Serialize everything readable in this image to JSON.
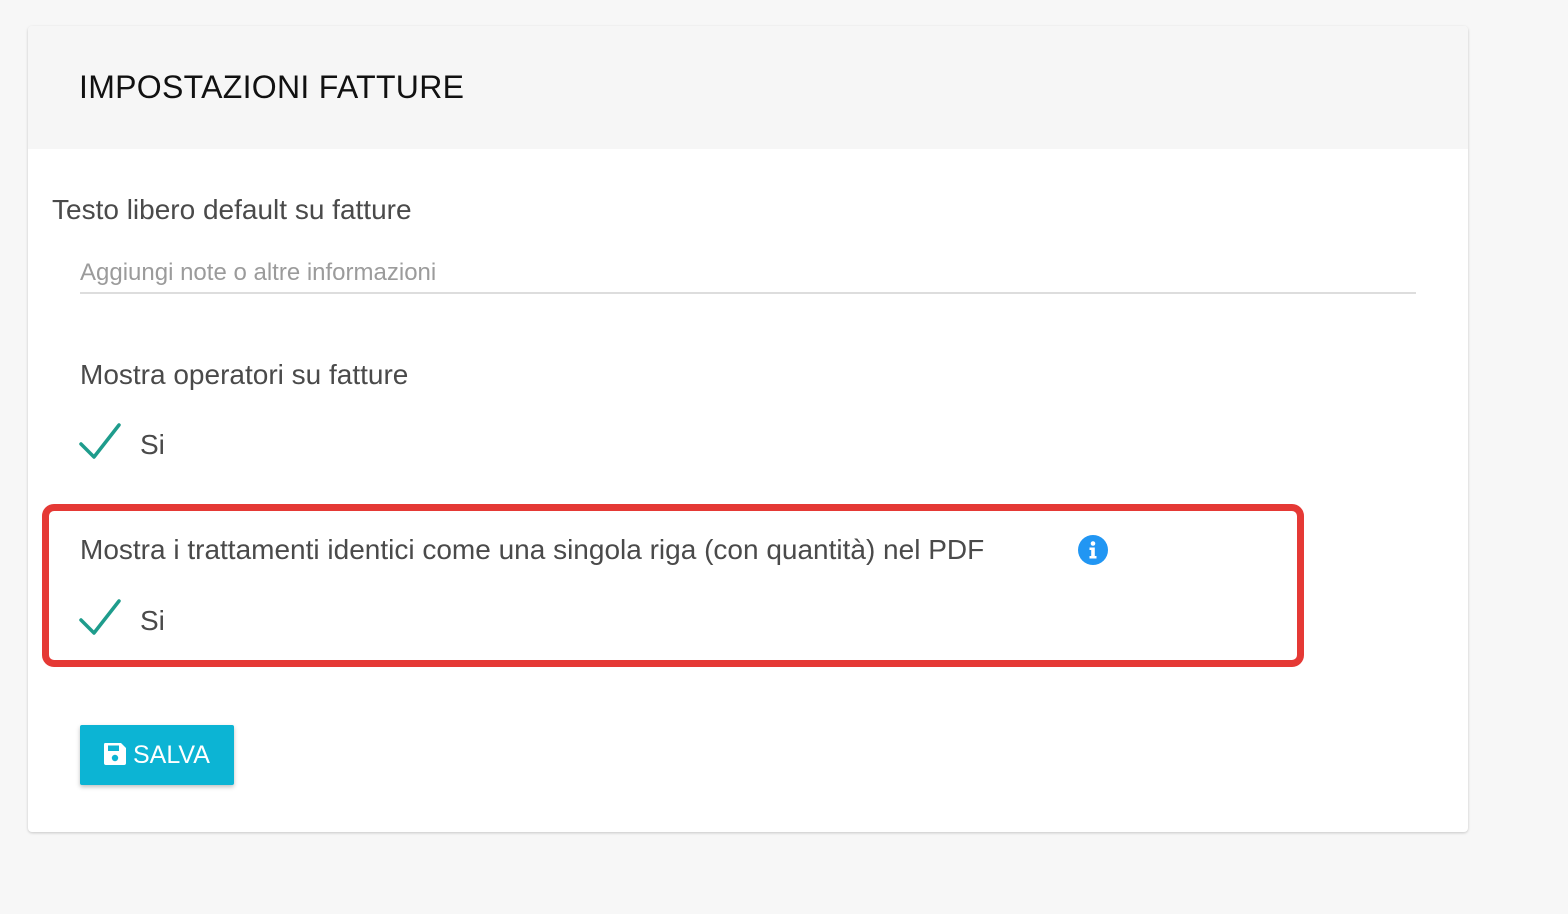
{
  "card": {
    "title": "IMPOSTAZIONI FATTURE"
  },
  "free_text": {
    "label": "Testo libero default su fatture",
    "value": "",
    "placeholder": "Aggiungi note o altre informazioni"
  },
  "show_operators": {
    "label": "Mostra operatori su fatture",
    "checked": true,
    "option_label": "Si"
  },
  "group_treatments": {
    "label": "Mostra i trattamenti identici come una singola riga (con quantità) nel PDF",
    "checked": true,
    "option_label": "Si",
    "info_icon": "info-circle-icon"
  },
  "save_button": {
    "label": "SALVA",
    "icon": "floppy-disk-icon"
  },
  "colors": {
    "accent": "#0cb4d4",
    "check": "#1e9c8c",
    "info": "#2196f3",
    "highlight": "#e53935"
  }
}
